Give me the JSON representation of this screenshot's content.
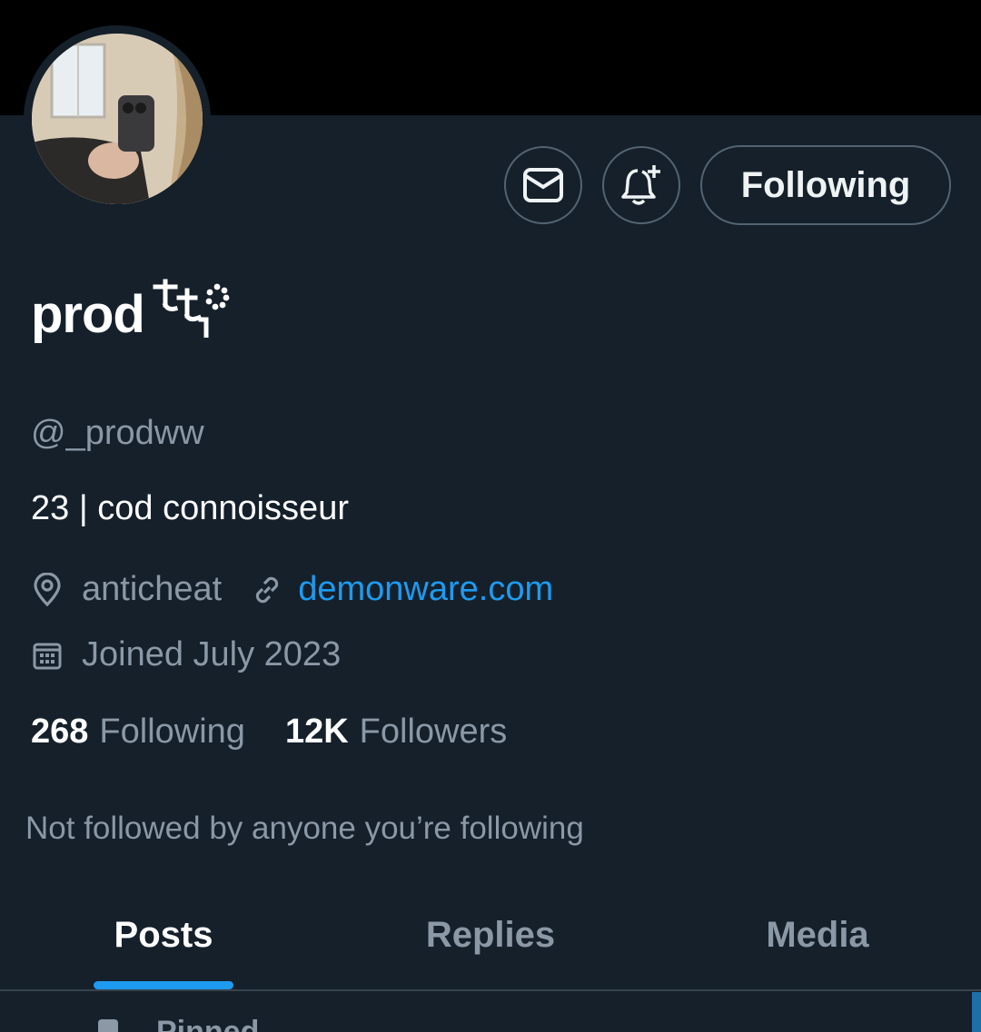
{
  "profile": {
    "display_name": "prod",
    "handle": "@_prodww",
    "bio": "23 | cod connoisseur",
    "location": "anticheat",
    "website": "demonware.com",
    "joined": "Joined July 2023"
  },
  "actions": {
    "message_icon": "envelope-icon",
    "notify_icon": "bell-plus-icon",
    "follow_label": "Following"
  },
  "stats": {
    "following_count": "268",
    "following_label": "Following",
    "followers_count": "12K",
    "followers_label": "Followers"
  },
  "followed_by_text": "Not followed by anyone you’re following",
  "tabs": [
    {
      "label": "Posts",
      "active": true
    },
    {
      "label": "Replies",
      "active": false
    },
    {
      "label": "Media",
      "active": false
    }
  ],
  "pinned_label": "Pinned",
  "colors": {
    "background": "#15202b",
    "banner": "#000000",
    "accent": "#1d9bf0",
    "muted_text": "#8b98a5",
    "border": "#536471"
  }
}
